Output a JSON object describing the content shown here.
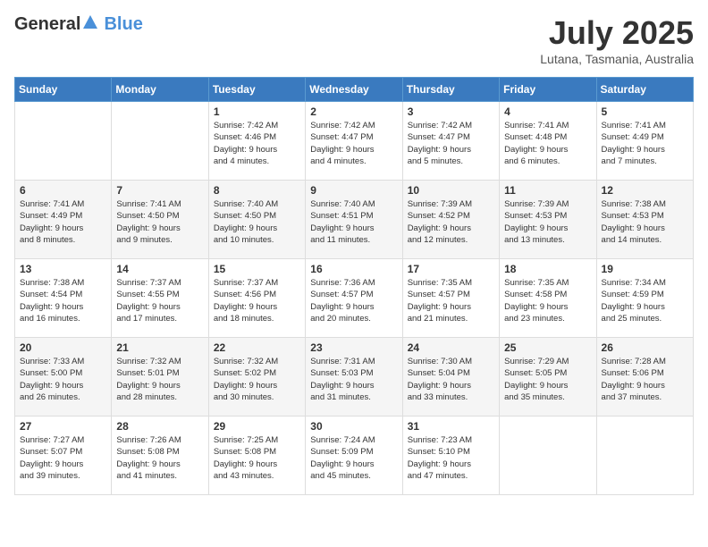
{
  "header": {
    "logo_general": "General",
    "logo_blue": "Blue",
    "title": "July 2025",
    "location": "Lutana, Tasmania, Australia"
  },
  "calendar": {
    "days_of_week": [
      "Sunday",
      "Monday",
      "Tuesday",
      "Wednesday",
      "Thursday",
      "Friday",
      "Saturday"
    ],
    "weeks": [
      [
        {
          "day": "",
          "info": ""
        },
        {
          "day": "",
          "info": ""
        },
        {
          "day": "1",
          "info": "Sunrise: 7:42 AM\nSunset: 4:46 PM\nDaylight: 9 hours\nand 4 minutes."
        },
        {
          "day": "2",
          "info": "Sunrise: 7:42 AM\nSunset: 4:47 PM\nDaylight: 9 hours\nand 4 minutes."
        },
        {
          "day": "3",
          "info": "Sunrise: 7:42 AM\nSunset: 4:47 PM\nDaylight: 9 hours\nand 5 minutes."
        },
        {
          "day": "4",
          "info": "Sunrise: 7:41 AM\nSunset: 4:48 PM\nDaylight: 9 hours\nand 6 minutes."
        },
        {
          "day": "5",
          "info": "Sunrise: 7:41 AM\nSunset: 4:49 PM\nDaylight: 9 hours\nand 7 minutes."
        }
      ],
      [
        {
          "day": "6",
          "info": "Sunrise: 7:41 AM\nSunset: 4:49 PM\nDaylight: 9 hours\nand 8 minutes."
        },
        {
          "day": "7",
          "info": "Sunrise: 7:41 AM\nSunset: 4:50 PM\nDaylight: 9 hours\nand 9 minutes."
        },
        {
          "day": "8",
          "info": "Sunrise: 7:40 AM\nSunset: 4:50 PM\nDaylight: 9 hours\nand 10 minutes."
        },
        {
          "day": "9",
          "info": "Sunrise: 7:40 AM\nSunset: 4:51 PM\nDaylight: 9 hours\nand 11 minutes."
        },
        {
          "day": "10",
          "info": "Sunrise: 7:39 AM\nSunset: 4:52 PM\nDaylight: 9 hours\nand 12 minutes."
        },
        {
          "day": "11",
          "info": "Sunrise: 7:39 AM\nSunset: 4:53 PM\nDaylight: 9 hours\nand 13 minutes."
        },
        {
          "day": "12",
          "info": "Sunrise: 7:38 AM\nSunset: 4:53 PM\nDaylight: 9 hours\nand 14 minutes."
        }
      ],
      [
        {
          "day": "13",
          "info": "Sunrise: 7:38 AM\nSunset: 4:54 PM\nDaylight: 9 hours\nand 16 minutes."
        },
        {
          "day": "14",
          "info": "Sunrise: 7:37 AM\nSunset: 4:55 PM\nDaylight: 9 hours\nand 17 minutes."
        },
        {
          "day": "15",
          "info": "Sunrise: 7:37 AM\nSunset: 4:56 PM\nDaylight: 9 hours\nand 18 minutes."
        },
        {
          "day": "16",
          "info": "Sunrise: 7:36 AM\nSunset: 4:57 PM\nDaylight: 9 hours\nand 20 minutes."
        },
        {
          "day": "17",
          "info": "Sunrise: 7:35 AM\nSunset: 4:57 PM\nDaylight: 9 hours\nand 21 minutes."
        },
        {
          "day": "18",
          "info": "Sunrise: 7:35 AM\nSunset: 4:58 PM\nDaylight: 9 hours\nand 23 minutes."
        },
        {
          "day": "19",
          "info": "Sunrise: 7:34 AM\nSunset: 4:59 PM\nDaylight: 9 hours\nand 25 minutes."
        }
      ],
      [
        {
          "day": "20",
          "info": "Sunrise: 7:33 AM\nSunset: 5:00 PM\nDaylight: 9 hours\nand 26 minutes."
        },
        {
          "day": "21",
          "info": "Sunrise: 7:32 AM\nSunset: 5:01 PM\nDaylight: 9 hours\nand 28 minutes."
        },
        {
          "day": "22",
          "info": "Sunrise: 7:32 AM\nSunset: 5:02 PM\nDaylight: 9 hours\nand 30 minutes."
        },
        {
          "day": "23",
          "info": "Sunrise: 7:31 AM\nSunset: 5:03 PM\nDaylight: 9 hours\nand 31 minutes."
        },
        {
          "day": "24",
          "info": "Sunrise: 7:30 AM\nSunset: 5:04 PM\nDaylight: 9 hours\nand 33 minutes."
        },
        {
          "day": "25",
          "info": "Sunrise: 7:29 AM\nSunset: 5:05 PM\nDaylight: 9 hours\nand 35 minutes."
        },
        {
          "day": "26",
          "info": "Sunrise: 7:28 AM\nSunset: 5:06 PM\nDaylight: 9 hours\nand 37 minutes."
        }
      ],
      [
        {
          "day": "27",
          "info": "Sunrise: 7:27 AM\nSunset: 5:07 PM\nDaylight: 9 hours\nand 39 minutes."
        },
        {
          "day": "28",
          "info": "Sunrise: 7:26 AM\nSunset: 5:08 PM\nDaylight: 9 hours\nand 41 minutes."
        },
        {
          "day": "29",
          "info": "Sunrise: 7:25 AM\nSunset: 5:08 PM\nDaylight: 9 hours\nand 43 minutes."
        },
        {
          "day": "30",
          "info": "Sunrise: 7:24 AM\nSunset: 5:09 PM\nDaylight: 9 hours\nand 45 minutes."
        },
        {
          "day": "31",
          "info": "Sunrise: 7:23 AM\nSunset: 5:10 PM\nDaylight: 9 hours\nand 47 minutes."
        },
        {
          "day": "",
          "info": ""
        },
        {
          "day": "",
          "info": ""
        }
      ]
    ]
  }
}
